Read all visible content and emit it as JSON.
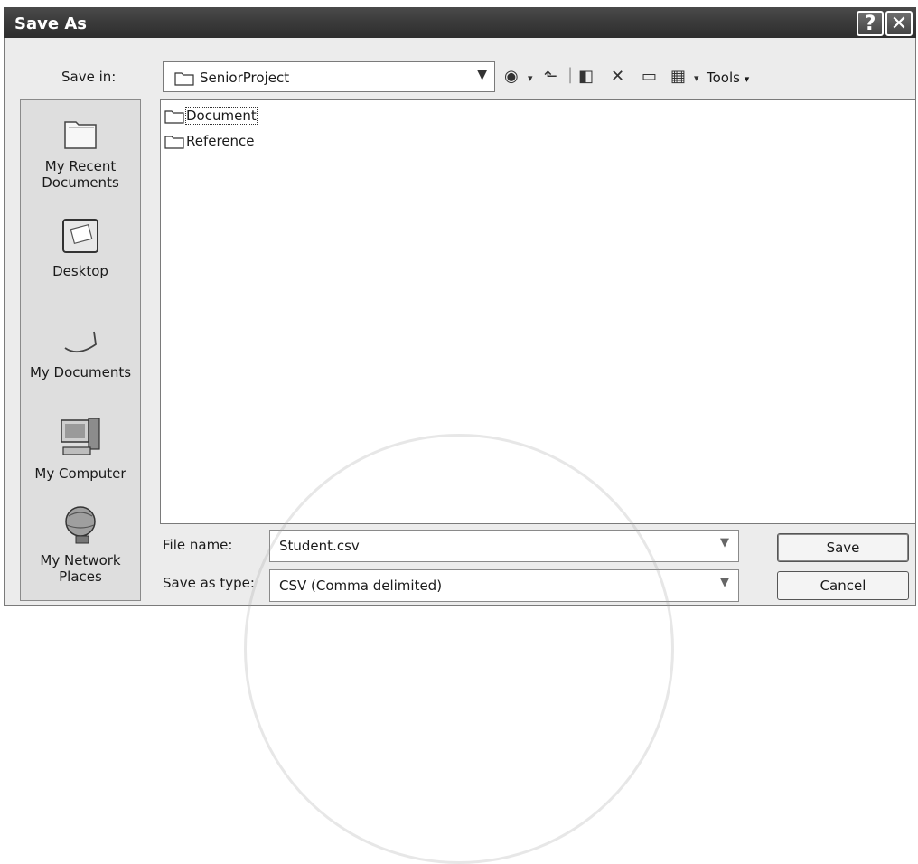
{
  "window": {
    "title": "Save As"
  },
  "titlebar": {
    "help_glyph": "?",
    "close_glyph": "✕"
  },
  "save_in": {
    "label": "Save in:",
    "value": "SeniorProject"
  },
  "toolbar": {
    "tools_label": "Tools"
  },
  "places": [
    {
      "label_line1": "My Recent",
      "label_line2": "Documents",
      "icon": "recent-documents-icon"
    },
    {
      "label_line1": "Desktop",
      "label_line2": "",
      "icon": "desktop-icon"
    },
    {
      "label_line1": "My Documents",
      "label_line2": "",
      "icon": "my-documents-icon"
    },
    {
      "label_line1": "My Computer",
      "label_line2": "",
      "icon": "my-computer-icon"
    },
    {
      "label_line1": "My Network",
      "label_line2": "Places",
      "icon": "network-places-icon"
    }
  ],
  "files": [
    {
      "name": "Document",
      "type": "folder"
    },
    {
      "name": "Reference",
      "type": "folder"
    }
  ],
  "file_name": {
    "label": "File name:",
    "value": "Student.csv"
  },
  "save_as_type": {
    "label": "Save as type:",
    "value": "CSV (Comma delimited)"
  },
  "buttons": {
    "save": "Save",
    "cancel": "Cancel"
  },
  "colors": {
    "titlebar": "#3a3a3a",
    "dialog_bg": "#ececec",
    "list_bg": "#ffffff"
  }
}
